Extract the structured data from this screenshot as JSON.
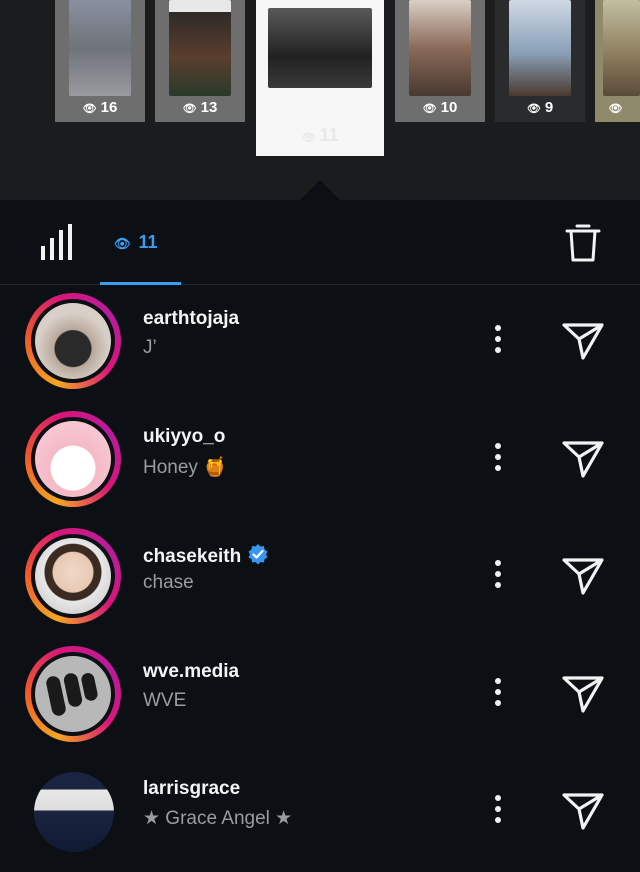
{
  "stories": [
    {
      "count": "16",
      "photo": "#8a8a8a"
    },
    {
      "count": "13",
      "photo": "#2e2a28"
    },
    {
      "count": "11",
      "active": true,
      "photo": "#444"
    },
    {
      "count": "10",
      "photo": "#b8a89a"
    },
    {
      "count": "9",
      "photo": "#7a8fa8"
    },
    {
      "count": "",
      "photo": "#b9b39a"
    }
  ],
  "tabs": {
    "views_count": "11"
  },
  "viewers": [
    {
      "username": "earthtojaja",
      "name": "J’",
      "verified": false
    },
    {
      "username": "ukiyyo_o",
      "name": "Honey 🍯",
      "verified": false
    },
    {
      "username": "chasekeith",
      "name": "chase",
      "verified": true
    },
    {
      "username": "wve.media",
      "name": "WVE",
      "verified": false
    },
    {
      "username": "larrisgrace",
      "name": "★ Grace Angel ★",
      "verified": false
    }
  ],
  "colors": {
    "accent": "#3b9cf0",
    "background": "#0c0f14",
    "verified": "#3897f0"
  },
  "icons": {
    "stats": "bar-chart-icon",
    "views": "eye-icon",
    "delete": "trash-icon",
    "more": "more-vertical-icon",
    "send": "send-icon"
  }
}
